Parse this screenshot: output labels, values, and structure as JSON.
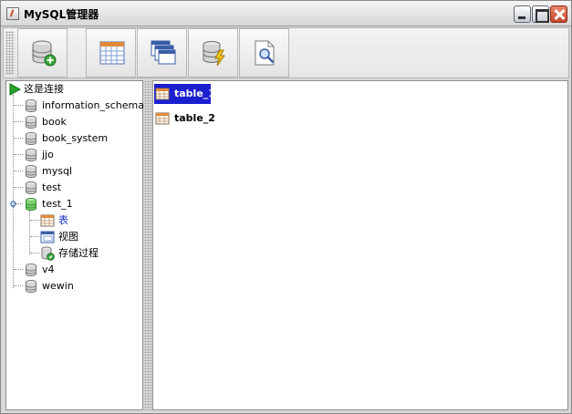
{
  "window": {
    "title": "MySQL管理器"
  },
  "toolbar": {
    "buttons": [
      {
        "name": "add-database",
        "icon": "database-add-icon"
      },
      {
        "name": "table-view",
        "icon": "table-icon"
      },
      {
        "name": "windows-view",
        "icon": "windows-icon"
      },
      {
        "name": "procedure",
        "icon": "database-lightning-icon"
      },
      {
        "name": "query",
        "icon": "document-search-icon"
      }
    ]
  },
  "tree": {
    "root": {
      "label": "这是连接",
      "icon": "play-icon"
    },
    "items": [
      {
        "label": "information_schema",
        "icon": "database-icon"
      },
      {
        "label": "book",
        "icon": "database-icon"
      },
      {
        "label": "book_system",
        "icon": "database-icon"
      },
      {
        "label": "jjo",
        "icon": "database-icon"
      },
      {
        "label": "mysql",
        "icon": "database-icon"
      },
      {
        "label": "test",
        "icon": "database-icon"
      },
      {
        "label": "test_1",
        "icon": "database-green-icon",
        "expanded": true,
        "children": [
          {
            "label": "表",
            "icon": "table-icon",
            "selected": true
          },
          {
            "label": "视图",
            "icon": "window-icon"
          },
          {
            "label": "存储过程",
            "icon": "procedure-icon"
          }
        ]
      },
      {
        "label": "v4",
        "icon": "database-icon"
      },
      {
        "label": "wewin",
        "icon": "database-icon"
      }
    ]
  },
  "tables": [
    {
      "label": "table_1",
      "selected": true
    },
    {
      "label": "table_2",
      "selected": false
    }
  ],
  "colors": {
    "selection": "#1a1fcf",
    "tree_selected_text": "#1731c4",
    "database_green": "#3aa63a"
  }
}
